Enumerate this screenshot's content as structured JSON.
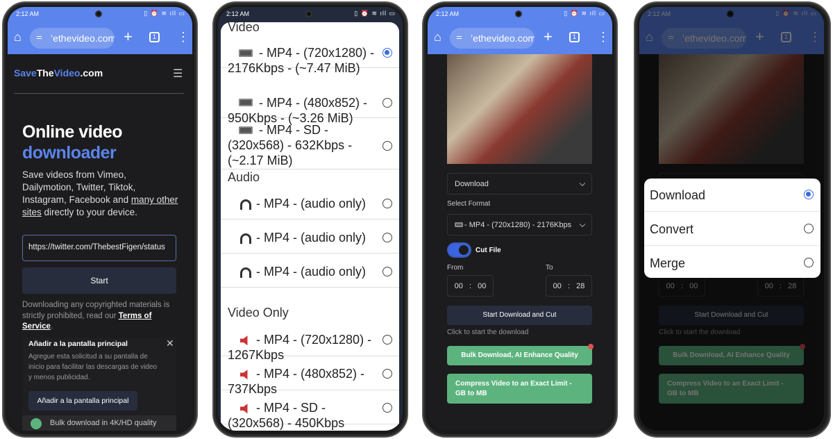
{
  "status_bar": {
    "time": "2:12 AM",
    "icons": "signal wifi alarm battery 87"
  },
  "browser": {
    "url": "’ethevideo.com",
    "tab_count": "1",
    "home_icon": "home-icon",
    "new_tab_icon": "plus-icon",
    "menu_icon": "kebab-icon",
    "accent": "#5b84ec"
  },
  "screen1": {
    "logo": {
      "save": "Save",
      "the": "The",
      "video": "Video",
      "com": ".com"
    },
    "title_line1": "Online video",
    "title_line2": "downloader",
    "desc_prefix": "Save videos from Vimeo, Dailymotion, Twitter, Tiktok, Instagram, Facebook and ",
    "desc_link": "many other sites",
    "desc_suffix": " directly to your device.",
    "url_input": "https://twitter.com/ThebestFigen/status",
    "start_label": "Start",
    "disclaimer": "Downloading any copyrighted materials is strictly prohibited, read our ",
    "terms_link": "Terms of Service",
    "disclaimer_end": ".",
    "card": {
      "title": "Añadir a la pantalla principal",
      "body": "Agregue esta solicitud a su pantalla de inicio para facilitar las descargas de video y menos publicidad.",
      "button": "Añadir a la pantalla principal"
    },
    "bulk_teaser": "Bulk download in 4K/HD quality"
  },
  "screen2": {
    "sections": [
      {
        "heading": "Video",
        "items": [
          {
            "icon": "vhs-icon",
            "label": " - MP4 - (720x1280) - 2176Kbps - (~7.47 MiB)",
            "selected": true
          },
          {
            "icon": "vhs-icon",
            "label": " - MP4 - (480x852) - 950Kbps - (~3.26 MiB)",
            "selected": false
          },
          {
            "icon": "vhs-icon",
            "label": " - MP4 - SD - (320x568) - 632Kbps - (~2.17 MiB)",
            "selected": false
          }
        ]
      },
      {
        "heading": "Audio",
        "items": [
          {
            "icon": "headphones-icon",
            "label": " - MP4 - (audio only)",
            "selected": false
          },
          {
            "icon": "headphones-icon",
            "label": " - MP4 - (audio only)",
            "selected": false
          },
          {
            "icon": "headphones-icon",
            "label": " - MP4 - (audio only)",
            "selected": false
          }
        ]
      },
      {
        "heading": "Video Only",
        "items": [
          {
            "icon": "muted-speaker-icon",
            "label": " - MP4 - (720x1280) - 1267Kbps",
            "selected": false
          },
          {
            "icon": "muted-speaker-icon",
            "label": " - MP4 - (480x852) - 737Kbps",
            "selected": false
          },
          {
            "icon": "muted-speaker-icon",
            "label": " - MP4 - SD - (320x568) - 450Kbps",
            "selected": false
          }
        ]
      }
    ]
  },
  "screen3": {
    "mode_select": "Download",
    "format_label": "Select Format",
    "format_select": " - MP4 - (720x1280) - 2176Kbps",
    "cut_label": "Cut File",
    "cut_on": true,
    "from_label": "From",
    "from_value": "00 : 00",
    "to_label": "To",
    "to_value": "00 : 28",
    "start_cut": "Start Download and Cut",
    "hint": "Click to start the download",
    "bulk": "Bulk Download, AI Enhance Quality",
    "compress": "Compress Video to an Exact Limit - GB to MB",
    "green": "#5db37e"
  },
  "screen4": {
    "options": [
      {
        "label": "Download",
        "selected": true
      },
      {
        "label": "Convert",
        "selected": false
      },
      {
        "label": "Merge",
        "selected": false
      }
    ]
  }
}
